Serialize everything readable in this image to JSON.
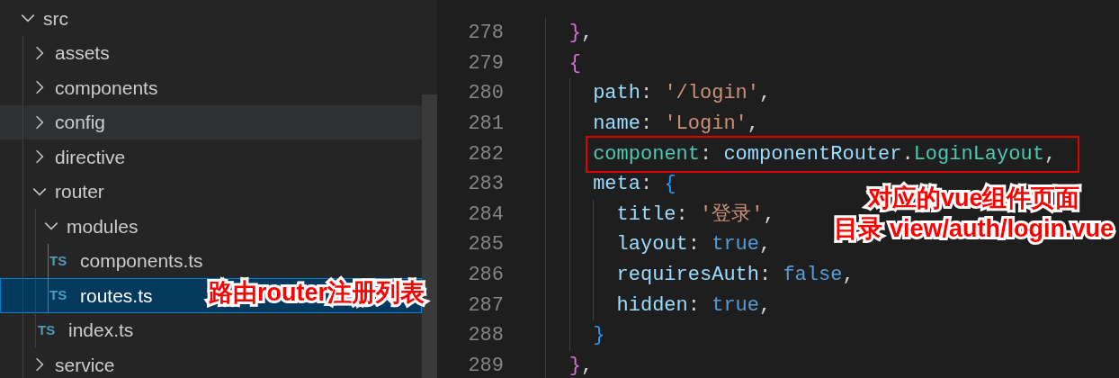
{
  "explorer": {
    "items": [
      {
        "label": "src",
        "kind": "folder",
        "expanded": true,
        "selected": false,
        "hovered": false,
        "children": [
          {
            "label": "assets",
            "kind": "folder",
            "expanded": false,
            "selected": false,
            "hovered": false
          },
          {
            "label": "components",
            "kind": "folder",
            "expanded": false,
            "selected": false,
            "hovered": false
          },
          {
            "label": "config",
            "kind": "folder",
            "expanded": false,
            "selected": false,
            "hovered": true
          },
          {
            "label": "directive",
            "kind": "folder",
            "expanded": false,
            "selected": false,
            "hovered": false
          },
          {
            "label": "router",
            "kind": "folder",
            "expanded": true,
            "selected": false,
            "hovered": false,
            "children": [
              {
                "label": "modules",
                "kind": "folder",
                "expanded": true,
                "selected": false,
                "hovered": false,
                "children": [
                  {
                    "label": "components.ts",
                    "kind": "file",
                    "badge": "TS",
                    "selected": false,
                    "hovered": false
                  },
                  {
                    "label": "routes.ts",
                    "kind": "file",
                    "badge": "TS",
                    "selected": true,
                    "hovered": false
                  }
                ]
              },
              {
                "label": "index.ts",
                "kind": "file",
                "badge": "TS",
                "selected": false,
                "hovered": false
              }
            ]
          },
          {
            "label": "service",
            "kind": "folder",
            "expanded": false,
            "selected": false,
            "hovered": false
          }
        ]
      }
    ]
  },
  "editor": {
    "lines": [
      {
        "number": "278",
        "tokens": [
          {
            "text": "}",
            "kind": "brace1"
          },
          {
            "text": ",",
            "kind": "punct"
          }
        ]
      },
      {
        "number": "279",
        "tokens": [
          {
            "text": "{",
            "kind": "brace1"
          }
        ],
        "children": [
          {
            "number": "280",
            "tokens": [
              {
                "text": "path",
                "kind": "key"
              },
              {
                "text": ": ",
                "kind": "punct"
              },
              {
                "text": "'/login'",
                "kind": "string"
              },
              {
                "text": ",",
                "kind": "punct"
              }
            ]
          },
          {
            "number": "281",
            "tokens": [
              {
                "text": "name",
                "kind": "key"
              },
              {
                "text": ": ",
                "kind": "punct"
              },
              {
                "text": "'Login'",
                "kind": "string"
              },
              {
                "text": ",",
                "kind": "punct"
              }
            ]
          },
          {
            "number": "282",
            "boxed": true,
            "tokens": [
              {
                "text": "component",
                "kind": "type"
              },
              {
                "text": ": ",
                "kind": "punct"
              },
              {
                "text": "componentRouter",
                "kind": "key"
              },
              {
                "text": ".",
                "kind": "punct"
              },
              {
                "text": "LoginLayout",
                "kind": "type"
              },
              {
                "text": ",",
                "kind": "punct"
              }
            ]
          },
          {
            "number": "283",
            "tokens": [
              {
                "text": "meta",
                "kind": "key"
              },
              {
                "text": ": ",
                "kind": "punct"
              },
              {
                "text": "{",
                "kind": "brace2"
              }
            ],
            "children": [
              {
                "number": "284",
                "tokens": [
                  {
                    "text": "title",
                    "kind": "key"
                  },
                  {
                    "text": ": ",
                    "kind": "punct"
                  },
                  {
                    "text": "'登录'",
                    "kind": "string"
                  },
                  {
                    "text": ",",
                    "kind": "punct"
                  }
                ]
              },
              {
                "number": "285",
                "tokens": [
                  {
                    "text": "layout",
                    "kind": "key"
                  },
                  {
                    "text": ": ",
                    "kind": "punct"
                  },
                  {
                    "text": "true",
                    "kind": "bool"
                  },
                  {
                    "text": ",",
                    "kind": "punct"
                  }
                ]
              },
              {
                "number": "286",
                "tokens": [
                  {
                    "text": "requiresAuth",
                    "kind": "key"
                  },
                  {
                    "text": ": ",
                    "kind": "punct"
                  },
                  {
                    "text": "false",
                    "kind": "bool"
                  },
                  {
                    "text": ",",
                    "kind": "punct"
                  }
                ]
              },
              {
                "number": "287",
                "tokens": [
                  {
                    "text": "hidden",
                    "kind": "key"
                  },
                  {
                    "text": ": ",
                    "kind": "punct"
                  },
                  {
                    "text": "true",
                    "kind": "bool"
                  },
                  {
                    "text": ",",
                    "kind": "punct"
                  }
                ]
              }
            ]
          },
          {
            "number": "288",
            "tokens": [
              {
                "text": "}",
                "kind": "brace2"
              }
            ]
          }
        ]
      },
      {
        "number": "289",
        "tokens": [
          {
            "text": "}",
            "kind": "brace1"
          },
          {
            "text": ",",
            "kind": "punct"
          }
        ]
      }
    ]
  },
  "callouts": [
    {
      "lines": [
        "路由router注册列表"
      ]
    },
    {
      "lines": [
        "对应的vue组件页面",
        "目录 view/auth/login.vue"
      ]
    }
  ]
}
